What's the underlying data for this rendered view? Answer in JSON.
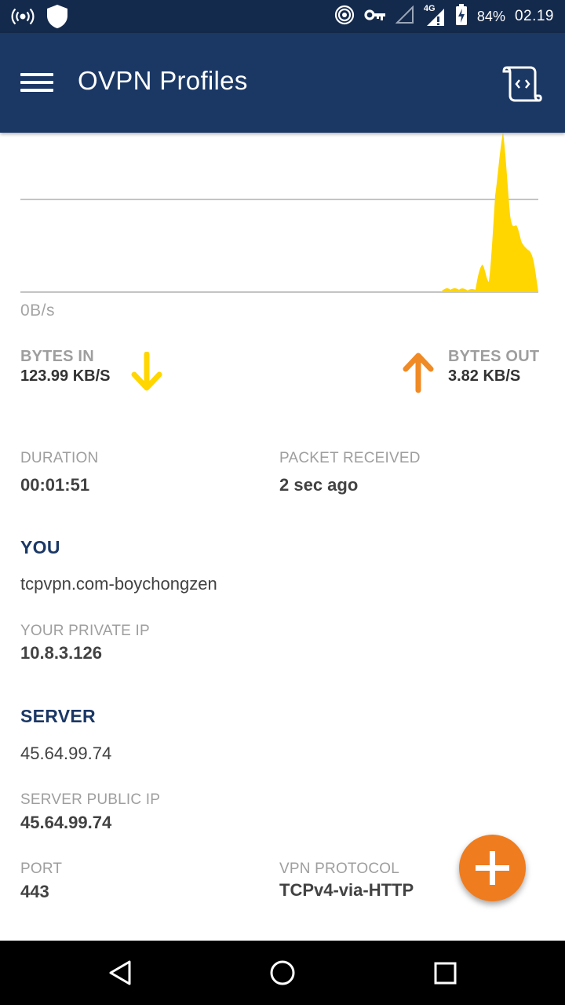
{
  "status_bar": {
    "left_icons": [
      "broadcast-icon",
      "shield-icon"
    ],
    "right_icons": [
      "hotspot-icon",
      "vpn-key-icon",
      "signal-empty-icon",
      "signal-4g-icon",
      "battery-charging-icon"
    ],
    "network_type": "4G",
    "battery": "84%",
    "time": "02.19"
  },
  "app_bar": {
    "title": "OVPN Profiles",
    "menu_icon": "hamburger-menu-icon",
    "action_icon": "log-scroll-icon"
  },
  "graph": {
    "zero_label": "0B/s",
    "incoming_color": "#ffd600",
    "line_color": "#b0b0b0"
  },
  "traffic": {
    "bytes_in_label": "BYTES IN",
    "bytes_in_value": "123.99 KB/S",
    "bytes_in_color": "#ffd600",
    "bytes_out_label": "BYTES OUT",
    "bytes_out_value": "3.82 KB/S",
    "bytes_out_color": "#f08a24"
  },
  "duration": {
    "label": "DURATION",
    "value": "00:01:51"
  },
  "packet": {
    "label": "PACKET RECEIVED",
    "value": "2 sec ago"
  },
  "you": {
    "heading": "YOU",
    "profile": "tcpvpn.com-boychongzen",
    "private_ip_label": "YOUR PRIVATE IP",
    "private_ip": "10.8.3.126"
  },
  "server": {
    "heading": "SERVER",
    "name": "45.64.99.74",
    "public_ip_label": "SERVER PUBLIC IP",
    "public_ip": "45.64.99.74",
    "port_label": "PORT",
    "port": "443",
    "protocol_label": "VPN PROTOCOL",
    "protocol": "TCPv4-via-HTTP"
  },
  "fab": {
    "icon": "plus-icon",
    "color": "#ef7c1f"
  },
  "nav_bar": {
    "buttons": [
      "back-icon",
      "home-icon",
      "recents-icon"
    ]
  }
}
